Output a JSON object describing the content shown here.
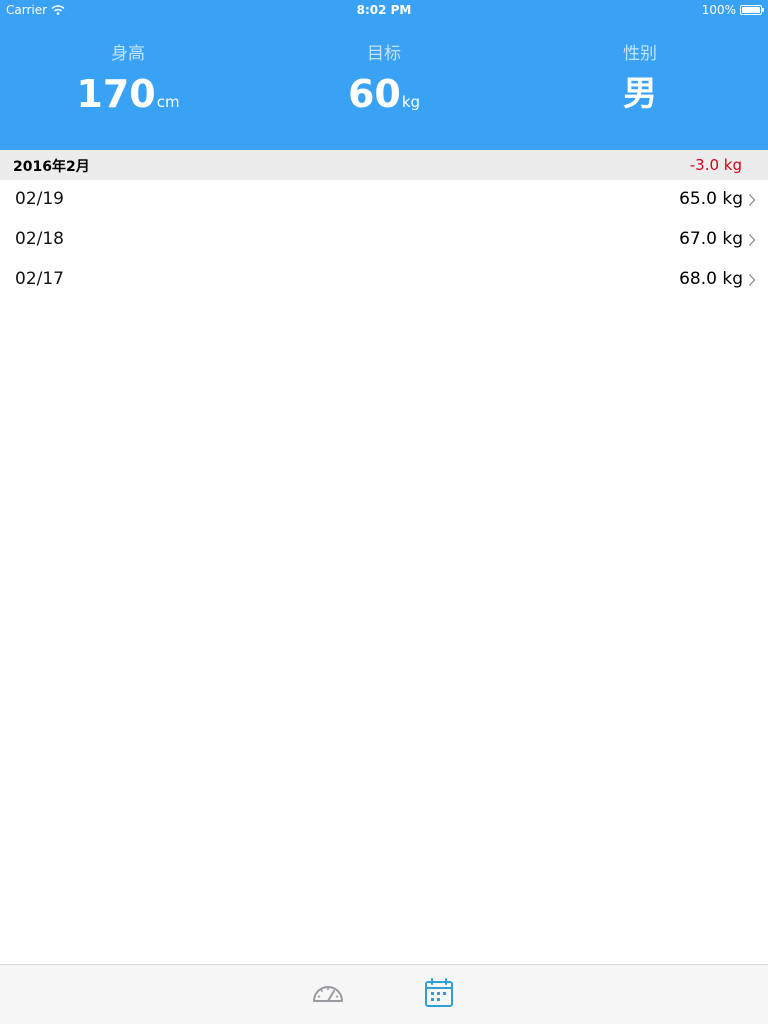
{
  "status_bar": {
    "carrier": "Carrier",
    "time": "8:02 PM",
    "battery": "100%"
  },
  "header": {
    "stats": [
      {
        "label": "身高",
        "value": "170",
        "unit": "cm"
      },
      {
        "label": "目标",
        "value": "60",
        "unit": "kg"
      },
      {
        "label": "性别",
        "value": "男"
      }
    ]
  },
  "section": {
    "title": "2016年2月",
    "change": "-3.0 kg"
  },
  "records": [
    {
      "date": "02/19",
      "weight": "65.0 kg"
    },
    {
      "date": "02/18",
      "weight": "67.0 kg"
    },
    {
      "date": "02/17",
      "weight": "68.0 kg"
    }
  ],
  "tabs": [
    {
      "icon": "dashboard-icon",
      "selected": false
    },
    {
      "icon": "calendar-icon",
      "selected": true
    }
  ],
  "colors": {
    "header_bg": "#3aa2f5",
    "negative_change": "#d0021b",
    "tab_active": "#2f9fd8",
    "tab_inactive": "#9a9aa0"
  }
}
